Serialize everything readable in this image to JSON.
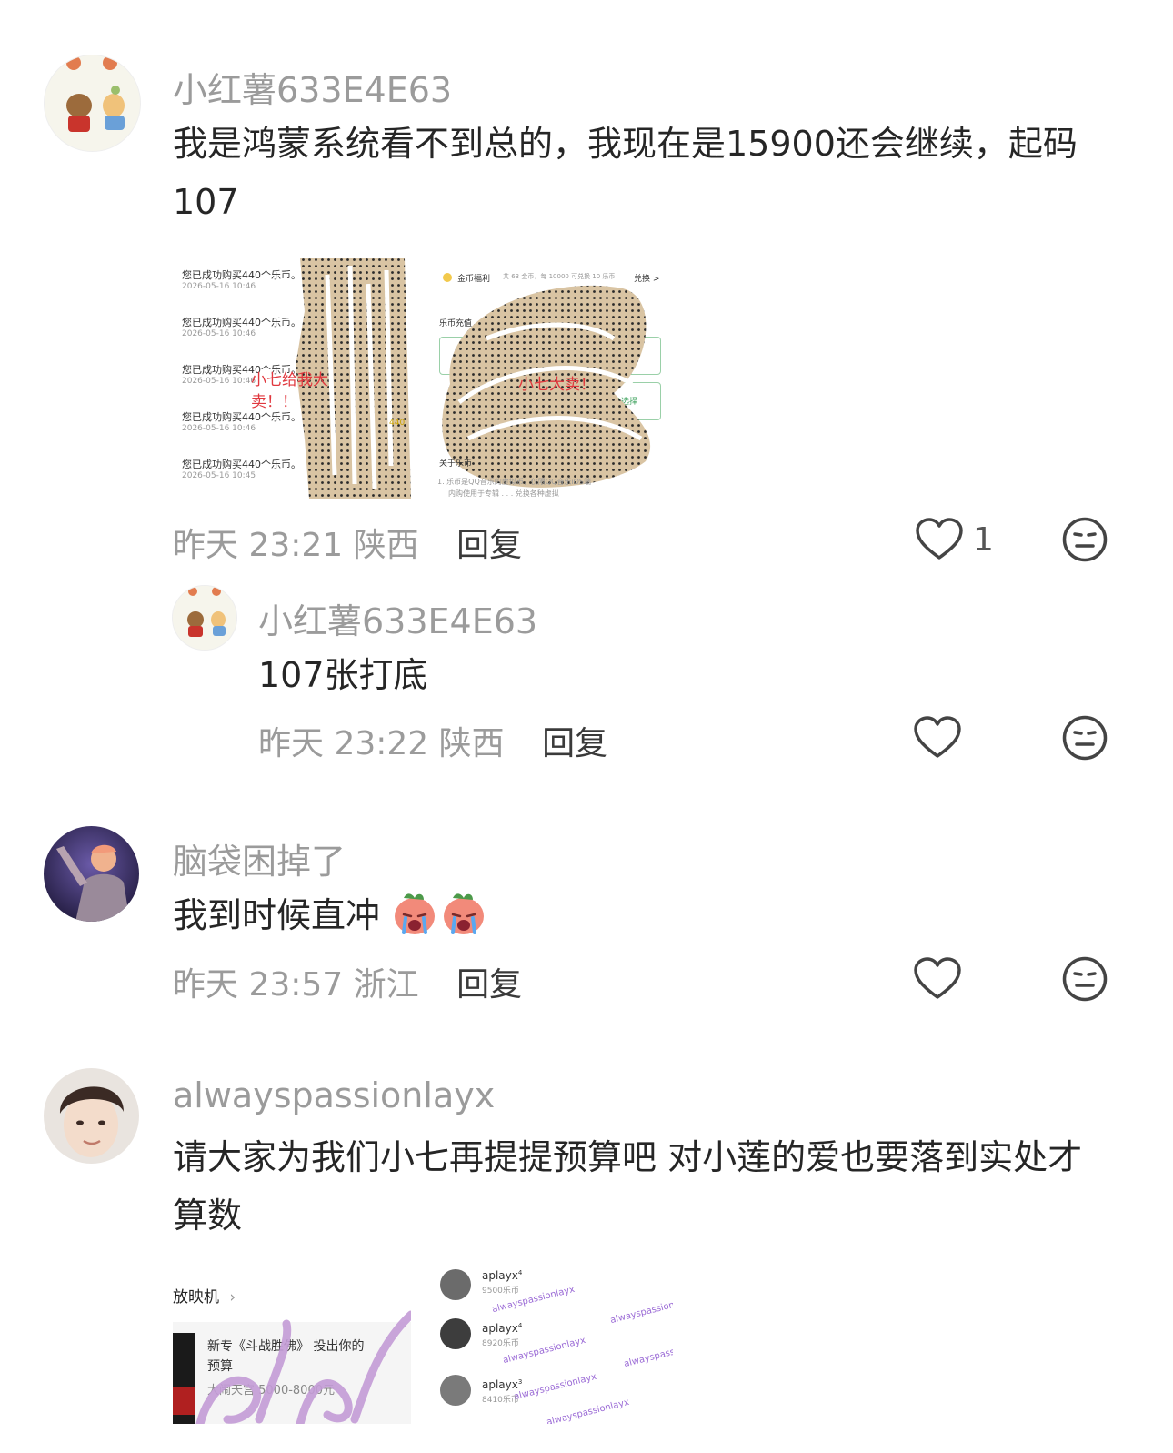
{
  "comments": [
    {
      "username": "小红薯633E4E63",
      "text": "我是鸿蒙系统看不到总的，我现在是15900还会继续，起码107",
      "time": "昨天 23:21",
      "location": "陕西",
      "reply_label": "回复",
      "likes": "1",
      "images": [
        {
          "lines": [
            "您已成功购买440个乐币。",
            "您已成功购买440个乐币。",
            "您已成功购买440个乐币。",
            "您已成功购买440个乐币。",
            "您已成功购买440个乐币。"
          ],
          "dates": [
            "2026-05-16 10:46",
            "2026-05-16 10:46",
            "2026-05-16 10:46",
            "2026-05-16 10:46",
            "2026-05-16 10:45"
          ],
          "overlay": "小七给我大卖！！",
          "side_value": "440"
        },
        {
          "top_label": "金币福利",
          "top_desc": "共 63 金币，每 10000 可兑换 10 乐币",
          "top_action": "兑换 >",
          "section": "乐币充值",
          "overlay": "小七大卖！",
          "more": "更多选择",
          "about": "关于乐币",
          "fine_print_1": "1. 乐币是QQ音乐的虚拟币，仅限QQ音乐iOS端",
          "fine_print_2": "内购使用于专辑 . . . 兑换各种虚拟"
        }
      ]
    },
    {
      "username": "小红薯633E4E63",
      "text": "107张打底",
      "time": "昨天 23:22",
      "location": "陕西",
      "reply_label": "回复"
    },
    {
      "username": "脑袋困掉了",
      "text": "我到时候直冲",
      "time": "昨天 23:57",
      "location": "浙江",
      "reply_label": "回复"
    },
    {
      "username": "alwayspassionlayx",
      "text": "请大家为我们小七再提提预算吧 对小莲的爱也要落到实处才算数",
      "images": [
        {
          "header": "放映机",
          "album_title": "新专《斗战胜佛》 投出你的",
          "album_title2": "预算",
          "album_sub": "大闹天宫 5000-8000元"
        },
        {
          "entries": [
            {
              "name": "aplayx",
              "sup": "4",
              "value": "9500乐币"
            },
            {
              "name": "aplayx",
              "sup": "4",
              "value": "8920乐币"
            },
            {
              "name": "aplayx",
              "sup": "3",
              "value": "8410乐币"
            }
          ],
          "watermark": "alwayspassionlayx"
        }
      ]
    }
  ],
  "colors": {
    "username": "#9b9b9b",
    "text": "#262626",
    "reply": "#3a3a3a",
    "scribble": "#d9c4a3"
  },
  "icons": [
    "heart-icon",
    "neutral-face-icon"
  ]
}
